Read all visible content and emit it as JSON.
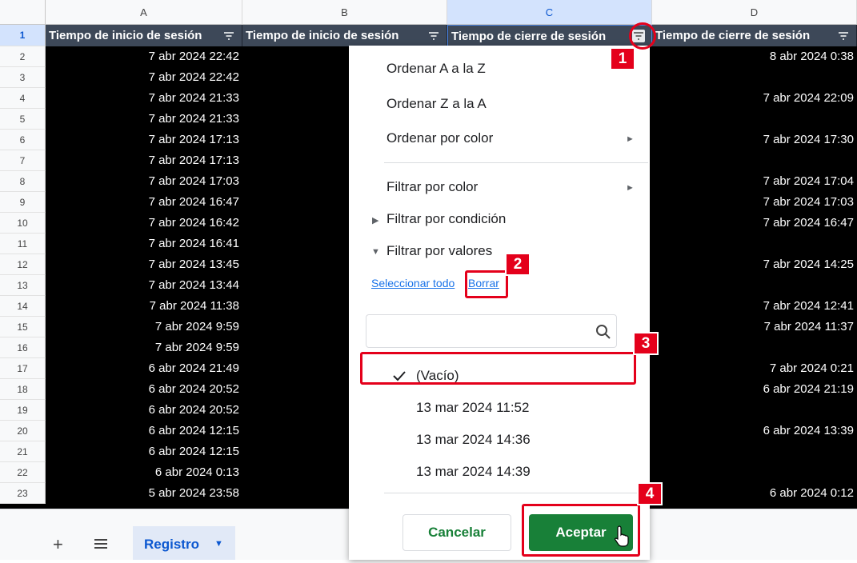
{
  "columns": {
    "a": "A",
    "b": "B",
    "c": "C",
    "d": "D"
  },
  "header_row_number": "1",
  "headers": {
    "a": "Tiempo de inicio de sesión",
    "b": "Tiempo de inicio de sesión",
    "c": "Tiempo de cierre de sesión",
    "d": "Tiempo de cierre de sesión"
  },
  "rows": [
    {
      "num": "2",
      "a": "7 abr 2024 22:42",
      "d": "8 abr 2024 0:38"
    },
    {
      "num": "3",
      "a": "7 abr 2024 22:42",
      "d": ""
    },
    {
      "num": "4",
      "a": "7 abr 2024 21:33",
      "d": "7 abr 2024 22:09"
    },
    {
      "num": "5",
      "a": "7 abr 2024 21:33",
      "d": ""
    },
    {
      "num": "6",
      "a": "7 abr 2024 17:13",
      "d": "7 abr 2024 17:30"
    },
    {
      "num": "7",
      "a": "7 abr 2024 17:13",
      "d": ""
    },
    {
      "num": "8",
      "a": "7 abr 2024 17:03",
      "d": "7 abr 2024 17:04"
    },
    {
      "num": "9",
      "a": "7 abr 2024 16:47",
      "d": "7 abr 2024 17:03"
    },
    {
      "num": "10",
      "a": "7 abr 2024 16:42",
      "d": "7 abr 2024 16:47"
    },
    {
      "num": "11",
      "a": "7 abr 2024 16:41",
      "d": ""
    },
    {
      "num": "12",
      "a": "7 abr 2024 13:45",
      "d": "7 abr 2024 14:25"
    },
    {
      "num": "13",
      "a": "7 abr 2024 13:44",
      "d": ""
    },
    {
      "num": "14",
      "a": "7 abr 2024 11:38",
      "d": "7 abr 2024 12:41"
    },
    {
      "num": "15",
      "a": "7 abr 2024 9:59",
      "d": "7 abr 2024 11:37"
    },
    {
      "num": "16",
      "a": "7 abr 2024 9:59",
      "d": ""
    },
    {
      "num": "17",
      "a": "6 abr 2024 21:49",
      "d": "7 abr 2024 0:21"
    },
    {
      "num": "18",
      "a": "6 abr 2024 20:52",
      "d": "6 abr 2024 21:19"
    },
    {
      "num": "19",
      "a": "6 abr 2024 20:52",
      "d": ""
    },
    {
      "num": "20",
      "a": "6 abr 2024 12:15",
      "d": "6 abr 2024 13:39"
    },
    {
      "num": "21",
      "a": "6 abr 2024 12:15",
      "d": ""
    },
    {
      "num": "22",
      "a": "6 abr 2024 0:13",
      "d": ""
    },
    {
      "num": "23",
      "a": "5 abr 2024 23:58",
      "d": "6 abr 2024 0:12"
    }
  ],
  "menu": {
    "sort_az": "Ordenar A a la Z",
    "sort_za": "Ordenar Z a la A",
    "sort_color": "Ordenar por color",
    "filter_color": "Filtrar por color",
    "filter_condition": "Filtrar por condición",
    "filter_values": "Filtrar por valores",
    "select_all": "Seleccionar todo",
    "clear": "Borrar",
    "search_value": "",
    "values": [
      {
        "label": "(Vacío)",
        "checked": true
      },
      {
        "label": "13 mar 2024 11:52",
        "checked": false
      },
      {
        "label": "13 mar 2024 14:36",
        "checked": false
      },
      {
        "label": "13 mar 2024 14:39",
        "checked": false
      }
    ],
    "cancel": "Cancelar",
    "ok": "Aceptar"
  },
  "bottom": {
    "add": "+",
    "sheet_tab": "Registro"
  },
  "annotations": [
    "1",
    "2",
    "3",
    "4"
  ],
  "colors": {
    "header_bg": "#3d4858",
    "accent_green": "#188038",
    "annotation_red": "#e4001b"
  }
}
